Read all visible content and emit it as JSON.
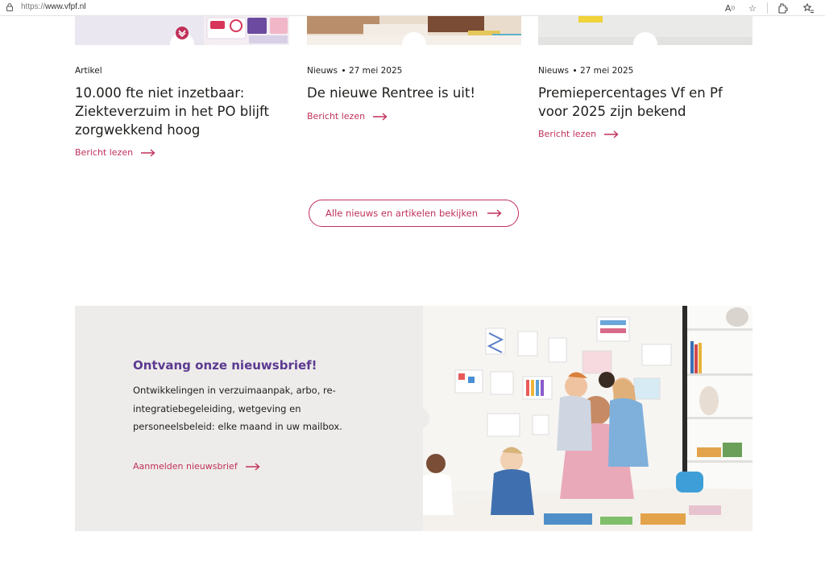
{
  "browser": {
    "url_protocol": "https://",
    "url_host": "www.vfpf.nl",
    "icons": [
      "lock-icon",
      "read-aloud-icon",
      "favorite-star-icon",
      "extensions-icon",
      "favorites-list-icon"
    ]
  },
  "cards": [
    {
      "category": "Artikel",
      "date": "",
      "title": "10.000 fte niet inzetbaar: Ziekteverzuim in het PO blijft zorgwekkend hoog",
      "read_more": "Bericht lezen"
    },
    {
      "category": "Nieuws",
      "date": "27 mei 2025",
      "title": "De nieuwe Rentree is uit!",
      "read_more": "Bericht lezen"
    },
    {
      "category": "Nieuws",
      "date": "27 mei 2025",
      "title": "Premiepercentages Vf en Pf voor 2025 zijn bekend",
      "read_more": "Bericht lezen"
    }
  ],
  "all_news_button": "Alle nieuws en artikelen bekijken",
  "newsletter": {
    "title": "Ontvang onze nieuwsbrief!",
    "text": "Ontwikkelingen in verzuimaanpak, arbo, re-integratiebegeleiding, wetgeving en personeelsbeleid: elke maand in uw mailbox.",
    "link": "Aanmelden nieuwsbrief"
  },
  "colors": {
    "accent": "#c0315a",
    "newsletter_title": "#5b3a91",
    "newsletter_bg": "#eeecea"
  }
}
